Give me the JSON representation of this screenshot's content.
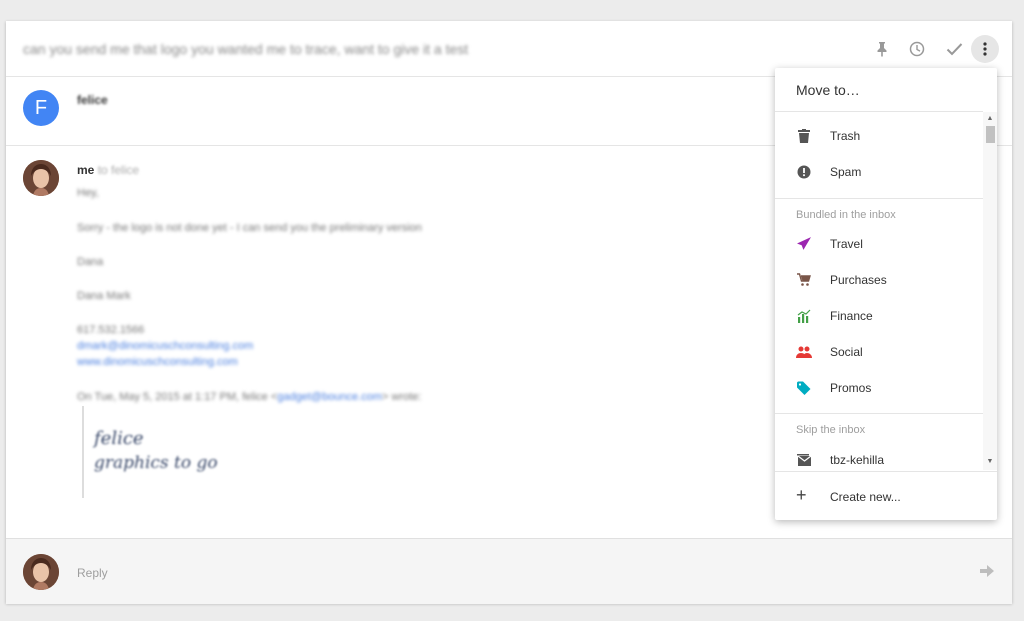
{
  "thread": {
    "subject": "can you send me that logo you wanted me to trace, want to give it a test",
    "first_message": {
      "avatar_letter": "F",
      "sender": "felice"
    },
    "second_message": {
      "sender": "me",
      "to": "to felice",
      "greeting": "Hey,",
      "body": "Sorry - the logo is not done yet - I can send you the preliminary version",
      "sign1": "Dana",
      "sign2": "Dana Mark",
      "phone": "617.532.1566",
      "email_link": "dmark@dinomicuschconsulting.com",
      "web_link": "www.dinomicuschconsulting.com",
      "quote_header": "On Tue, May 5, 2015 at 1:17 PM, felice <",
      "quote_email": "gadget@bounce.com",
      "quote_tail": "> wrote:",
      "signature_line1": "felice",
      "signature_line2": "graphics to go"
    },
    "reply_placeholder": "Reply"
  },
  "menu": {
    "title": "Move to…",
    "top_items": [
      {
        "label": "Trash",
        "icon": "trash-icon"
      },
      {
        "label": "Spam",
        "icon": "spam-icon"
      }
    ],
    "bundled_label": "Bundled in the inbox",
    "bundled_items": [
      {
        "label": "Travel",
        "icon": "plane-icon",
        "color": "#9c27b0"
      },
      {
        "label": "Purchases",
        "icon": "cart-icon",
        "color": "#795548"
      },
      {
        "label": "Finance",
        "icon": "chart-icon",
        "color": "#43a047"
      },
      {
        "label": "Social",
        "icon": "people-icon",
        "color": "#e53935"
      },
      {
        "label": "Promos",
        "icon": "tag-icon",
        "color": "#00acc1"
      }
    ],
    "skip_label": "Skip the inbox",
    "skip_items": [
      {
        "label": "tbz-kehilla",
        "icon": "label-envelope-icon"
      }
    ],
    "create_label": "Create new..."
  }
}
